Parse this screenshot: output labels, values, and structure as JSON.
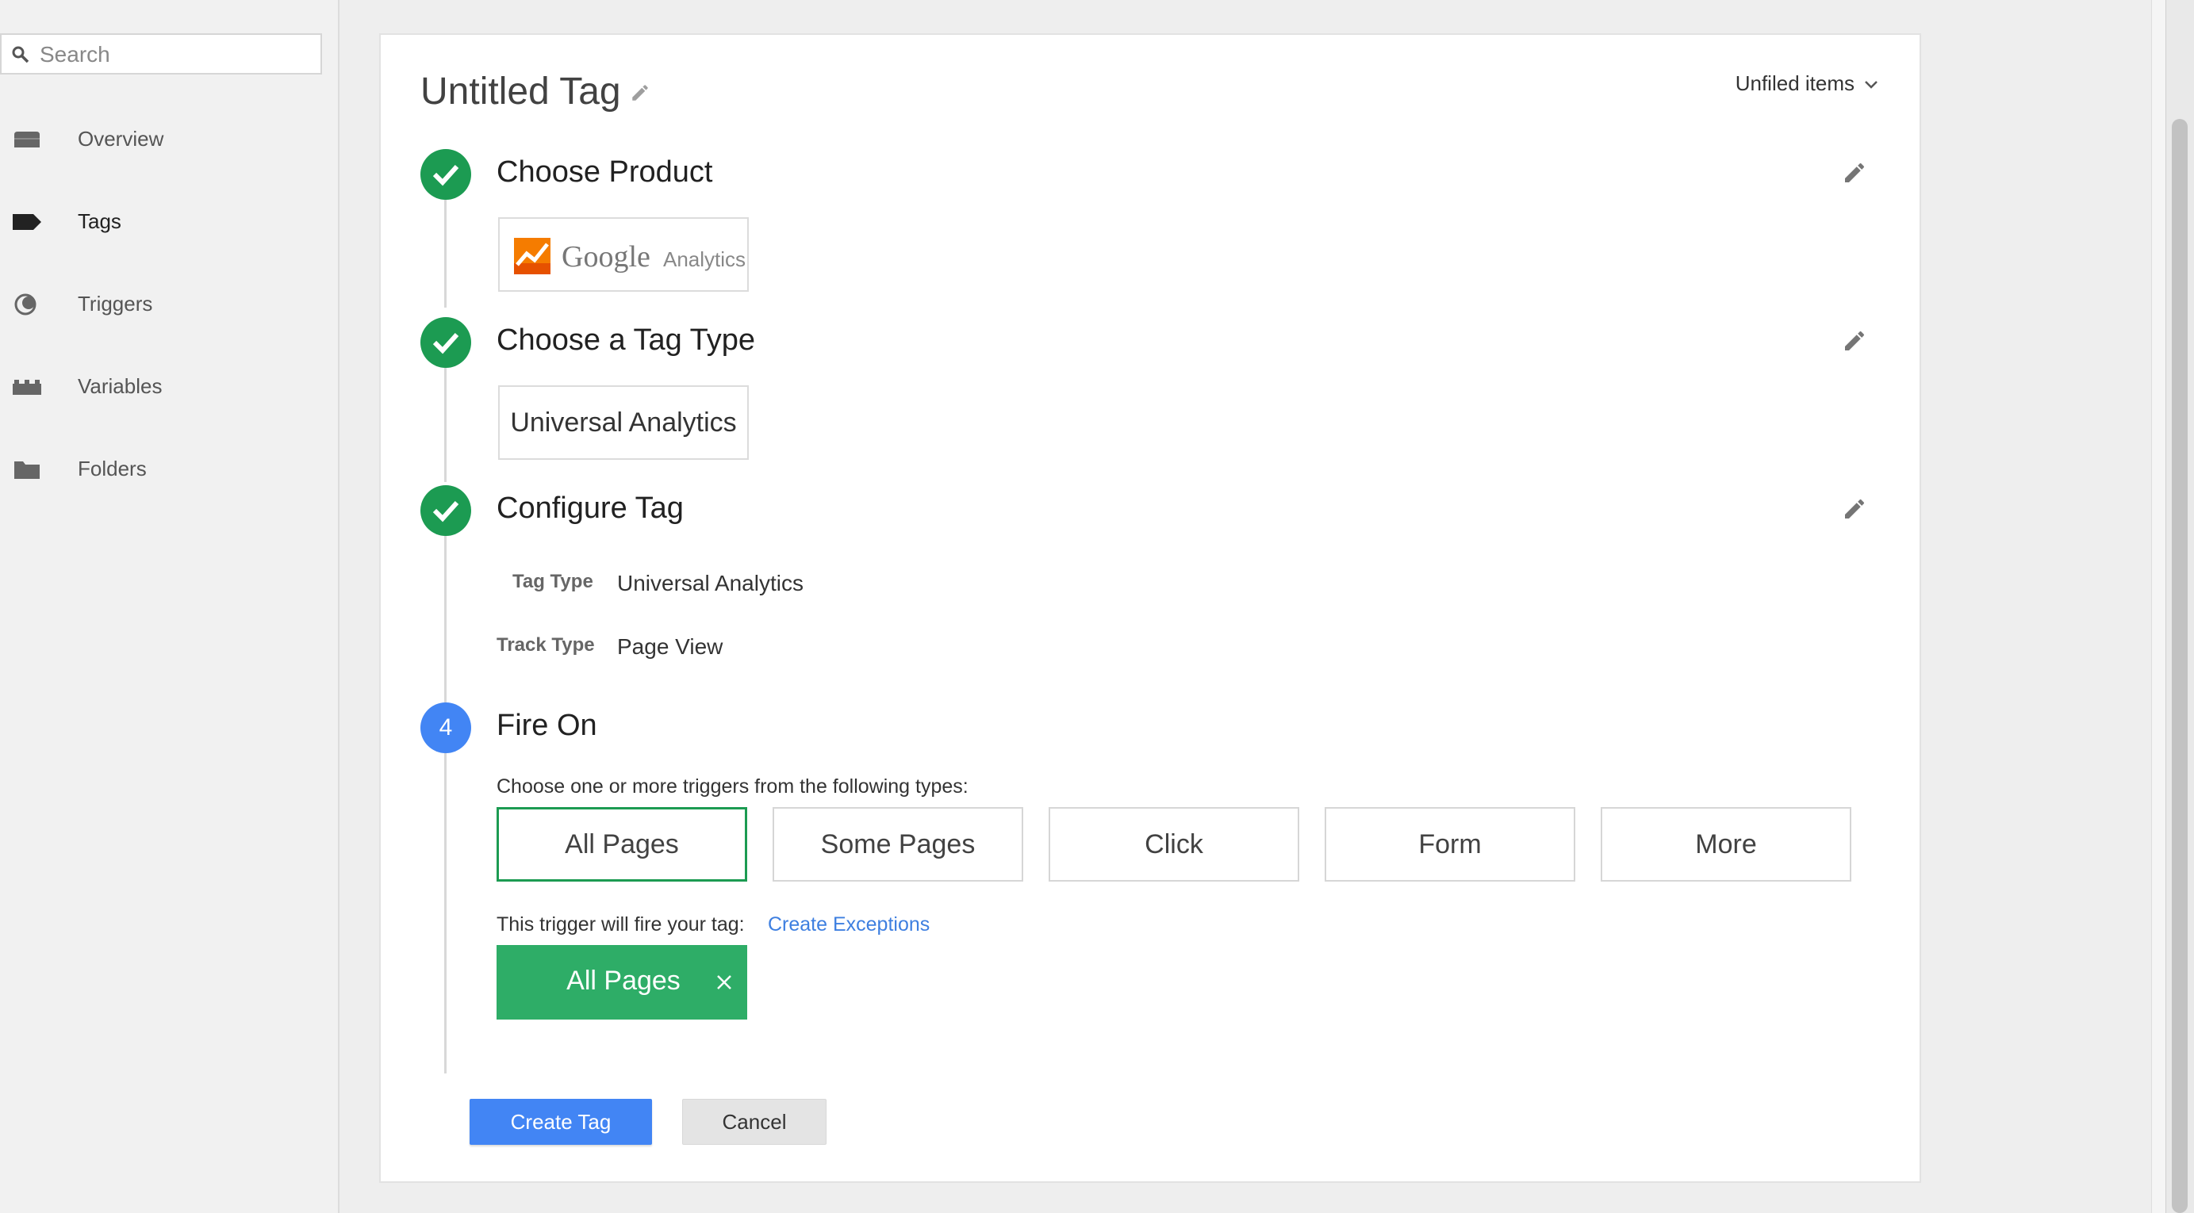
{
  "sidebar": {
    "search_placeholder": "Search",
    "items": [
      {
        "label": "Overview",
        "icon": "briefcase-icon"
      },
      {
        "label": "Tags",
        "icon": "tag-icon"
      },
      {
        "label": "Triggers",
        "icon": "trigger-icon"
      },
      {
        "label": "Variables",
        "icon": "blocks-icon"
      },
      {
        "label": "Folders",
        "icon": "folder-icon"
      }
    ],
    "active": "Tags"
  },
  "header": {
    "title": "Untitled Tag",
    "folder_select": "Unfiled items"
  },
  "steps": [
    {
      "title": "Choose Product",
      "status": "complete"
    },
    {
      "title": "Choose a Tag Type",
      "status": "complete"
    },
    {
      "title": "Configure Tag",
      "status": "complete"
    },
    {
      "title": "Fire On",
      "status": "current",
      "number": "4"
    }
  ],
  "product": {
    "logo_word": "Google",
    "logo_product": "Analytics"
  },
  "tag_type": {
    "chip": "Universal Analytics"
  },
  "configure": {
    "rows": [
      {
        "label": "Tag Type",
        "value": "Universal Analytics"
      },
      {
        "label": "Track Type",
        "value": "Page View"
      }
    ]
  },
  "fire_on": {
    "instruction": "Choose one or more triggers from the following types:",
    "types": [
      "All Pages",
      "Some Pages",
      "Click",
      "Form",
      "More"
    ],
    "selected_type": "All Pages",
    "fire_text": "This trigger will fire your tag:",
    "exceptions_link": "Create Exceptions",
    "selected_trigger": "All Pages"
  },
  "actions": {
    "create": "Create Tag",
    "cancel": "Cancel"
  },
  "colors": {
    "complete": "#1c9b52",
    "current": "#4285f4",
    "trigger_chip": "#2ead67",
    "link": "#3e7fe0"
  }
}
